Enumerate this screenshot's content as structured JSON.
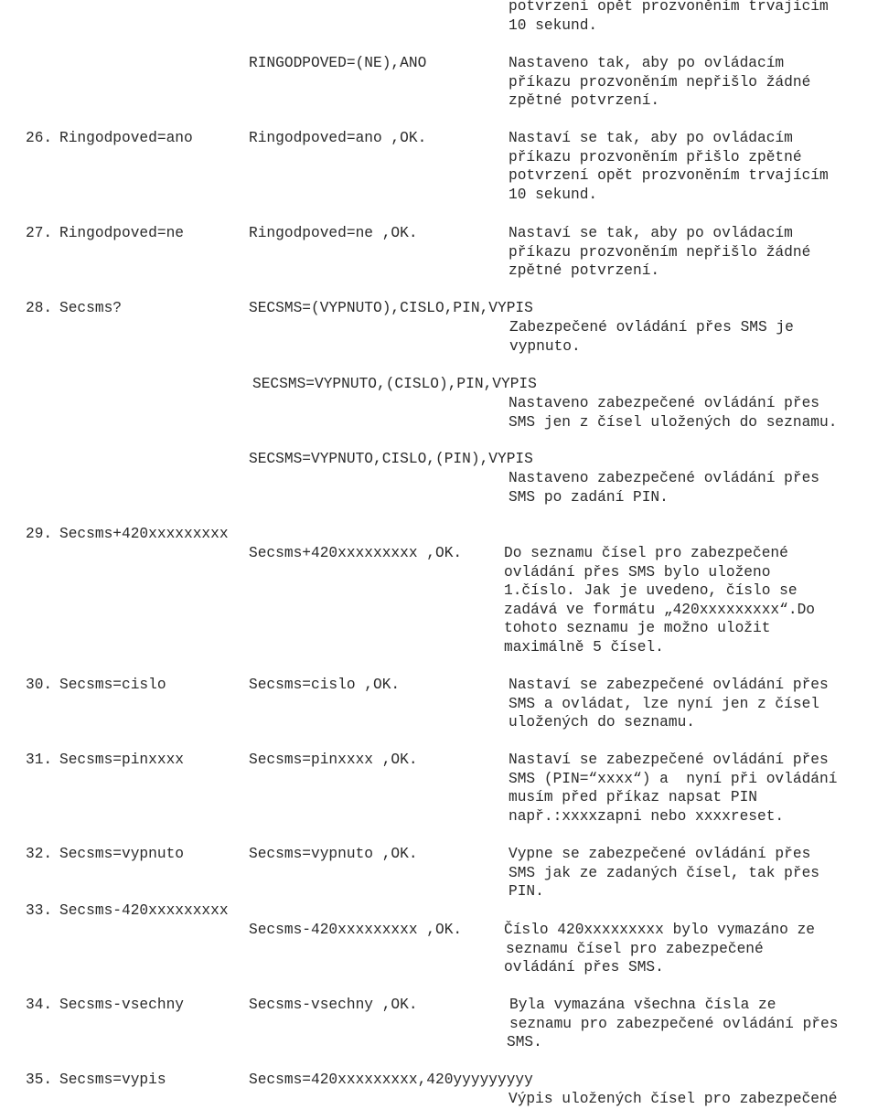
{
  "document": {
    "intro": {
      "desc_tail": [
        "potvrzení opět prozvoněním trvajícím",
        "10 sekund."
      ],
      "alt_response": "RINGODPOVED=(NE),ANO",
      "alt_desc": [
        "Nastaveno tak, aby po ovládacím",
        "příkazu prozvoněním nepřišlo žádné",
        "zpětné potvrzení."
      ]
    },
    "rows": [
      {
        "number": "26.",
        "command": "Ringodpoved=ano",
        "response": "Ringodpoved=ano ,OK.",
        "description": [
          "Nastaví se tak, aby po ovládacím",
          "příkazu prozvoněním přišlo zpětné",
          "potvrzení opět prozvoněním trvajícím",
          "10 sekund."
        ]
      },
      {
        "number": "27.",
        "command": "Ringodpoved=ne",
        "response": "Ringodpoved=ne ,OK.",
        "description": [
          "Nastaví se tak, aby po ovládacím",
          "příkazu prozvoněním nepřišlo žádné",
          "zpětné potvrzení."
        ]
      },
      {
        "number": "28.",
        "command": "Secsms?",
        "variants": [
          {
            "response": "SECSMS=(VYPNUTO),CISLO,PIN,VYPIS",
            "description": [
              "Zabezpečené ovládání přes SMS je",
              "vypnuto."
            ]
          },
          {
            "response": "SECSMS=VYPNUTO,(CISLO),PIN,VYPIS",
            "description": [
              "Nastaveno zabezpečené ovládání přes",
              "SMS jen z čísel uložených do seznamu."
            ]
          },
          {
            "response": "SECSMS=VYPNUTO,CISLO,(PIN),VYPIS",
            "description": [
              "Nastaveno zabezpečené ovládání přes",
              "SMS po zadání PIN."
            ]
          }
        ]
      },
      {
        "number": "29.",
        "command": "Secsms+420xxxxxxxxx",
        "response": "Secsms+420xxxxxxxxx ,OK.",
        "description": [
          "Do seznamu čísel pro zabezpečené",
          "ovládání přes SMS bylo uloženo",
          "1.číslo. Jak je uvedeno, číslo se",
          "zadává ve formátu „420xxxxxxxxx“.Do",
          "tohoto seznamu je možno uložit",
          "maximálně 5 čísel."
        ]
      },
      {
        "number": "30.",
        "command": "Secsms=cislo",
        "response": "Secsms=cislo ,OK.",
        "description": [
          "Nastaví se zabezpečené ovládání přes",
          "SMS a ovládat, lze nyní jen z čísel",
          "uložených do seznamu."
        ]
      },
      {
        "number": "31.",
        "command": "Secsms=pinxxxx",
        "response": "Secsms=pinxxxx ,OK.",
        "description": [
          "Nastaví se zabezpečené ovládání přes",
          "SMS (PIN=“xxxx“) a  nyní při ovládání",
          "musím před příkaz napsat PIN",
          "např.:xxxxzapni nebo xxxxreset."
        ]
      },
      {
        "number": "32.",
        "command": "Secsms=vypnuto",
        "response": "Secsms=vypnuto ,OK.",
        "description": [
          "Vypne se zabezpečené ovládání přes",
          "SMS jak ze zadaných čísel, tak přes",
          "PIN."
        ]
      },
      {
        "number": "33.",
        "command": "Secsms-420xxxxxxxxx",
        "response": "Secsms-420xxxxxxxxx ,OK.",
        "description": [
          "Číslo 420xxxxxxxxx bylo vymazáno ze",
          "seznamu čísel pro zabezpečené",
          "ovládání přes SMS."
        ]
      },
      {
        "number": "34.",
        "command": "Secsms-vsechny",
        "response": "Secsms-vsechny ,OK.",
        "description": [
          "Byla vymazána všechna čísla ze",
          "seznamu pro zabezpečené ovládání přes",
          "SMS."
        ]
      },
      {
        "number": "35.",
        "command": "Secsms=vypis",
        "response": "Secsms=420xxxxxxxxx,420yyyyyyyyy",
        "description": [
          "Výpis uložených čísel pro zabezpečené"
        ]
      }
    ]
  }
}
